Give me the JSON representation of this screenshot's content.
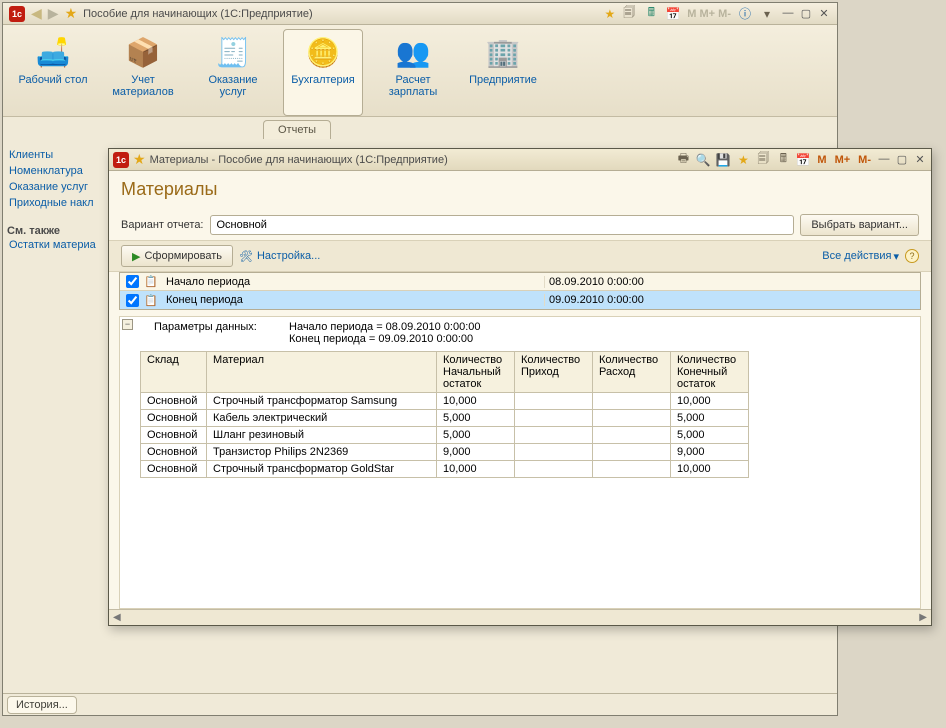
{
  "main": {
    "title": "Пособие для начинающих  (1С:Предприятие)",
    "sections": [
      {
        "label": "Рабочий стол"
      },
      {
        "label": "Учет материалов"
      },
      {
        "label": "Оказание услуг"
      },
      {
        "label": "Бухгалтерия"
      },
      {
        "label": "Расчет зарплаты"
      },
      {
        "label": "Предприятие"
      }
    ],
    "active_section_index": 3,
    "tab_label": "Отчеты",
    "nav": {
      "links": [
        "Клиенты",
        "Номенклатура",
        "Оказание услуг",
        "Приходные накл"
      ],
      "see_also_head": "См. также",
      "see_also": [
        "Остатки материа"
      ]
    },
    "history_button": "История..."
  },
  "report": {
    "title": "Материалы - Пособие для начинающих  (1С:Предприятие)",
    "m_buttons": [
      "M",
      "M+",
      "M-"
    ],
    "header": "Материалы",
    "variant_label": "Вариант отчета:",
    "variant_value": "Основной",
    "choose_variant": "Выбрать вариант...",
    "form_button": "Сформировать",
    "settings_link": "Настройка...",
    "all_actions": "Все действия",
    "params": {
      "row1": {
        "checked": true,
        "label": "Начало периода",
        "value": "08.09.2010 0:00:00"
      },
      "row2": {
        "checked": true,
        "label": "Конец периода",
        "value": "09.09.2010 0:00:00"
      }
    },
    "data_params": {
      "header": "Параметры данных:",
      "line1": "Начало периода = 08.09.2010 0:00:00",
      "line2": "Конец периода = 09.09.2010 0:00:00"
    },
    "columns": [
      "Склад",
      "Материал",
      "Количество Начальный остаток",
      "Количество Приход",
      "Количество Расход",
      "Количество Конечный остаток"
    ],
    "rows": [
      {
        "sklad": "Основной",
        "mat": "Строчный трансформатор Samsung",
        "q1": "10,000",
        "q2": "",
        "q3": "",
        "q4": "10,000"
      },
      {
        "sklad": "Основной",
        "mat": "Кабель электрический",
        "q1": "5,000",
        "q2": "",
        "q3": "",
        "q4": "5,000"
      },
      {
        "sklad": "Основной",
        "mat": "Шланг резиновый",
        "q1": "5,000",
        "q2": "",
        "q3": "",
        "q4": "5,000"
      },
      {
        "sklad": "Основной",
        "mat": "Транзистор Philips 2N2369",
        "q1": "9,000",
        "q2": "",
        "q3": "",
        "q4": "9,000"
      },
      {
        "sklad": "Основной",
        "mat": "Строчный трансформатор GoldStar",
        "q1": "10,000",
        "q2": "",
        "q3": "",
        "q4": "10,000"
      }
    ]
  }
}
